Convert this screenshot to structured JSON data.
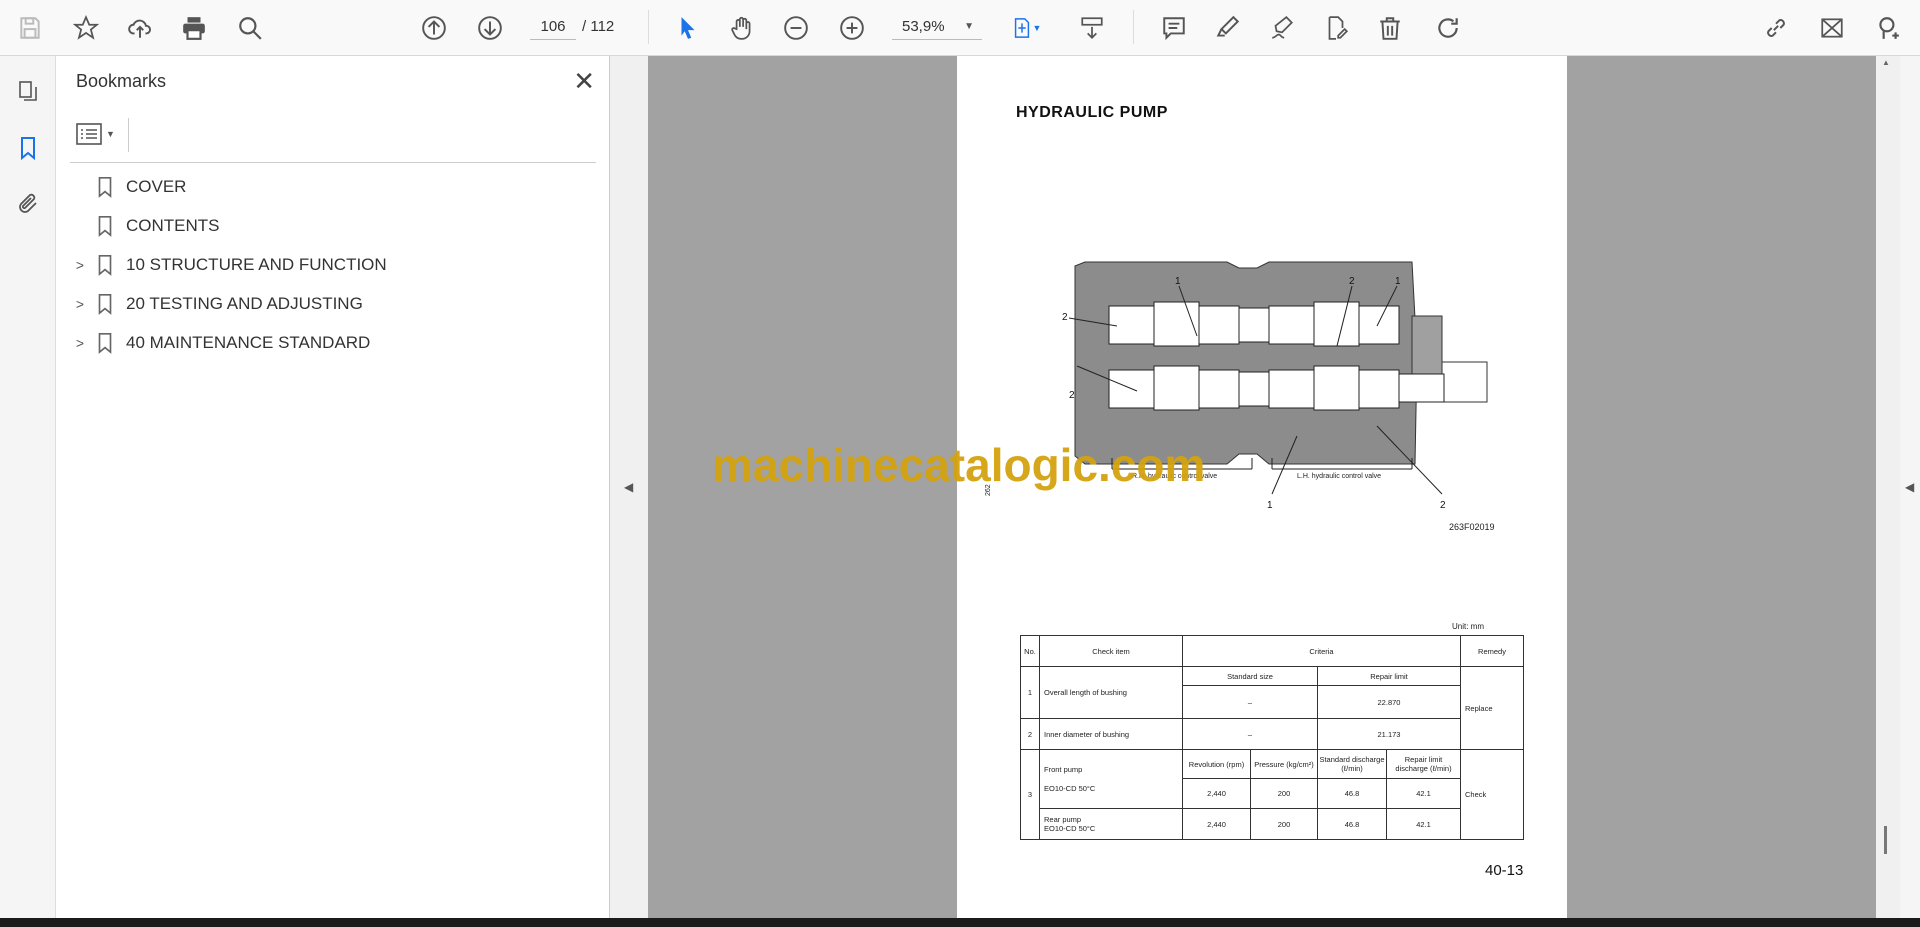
{
  "toolbar": {
    "page_current": "106",
    "page_total": "/ 112",
    "zoom": "53,9%",
    "accent_color": "#1a73e8"
  },
  "bookmarks": {
    "title": "Bookmarks",
    "items": [
      {
        "label": "COVER",
        "expandable": false
      },
      {
        "label": "CONTENTS",
        "expandable": false
      },
      {
        "label": "10 STRUCTURE AND FUNCTION",
        "expandable": true
      },
      {
        "label": "20 TESTING AND ADJUSTING",
        "expandable": true
      },
      {
        "label": "40 MAINTENANCE STANDARD",
        "expandable": true
      }
    ]
  },
  "document": {
    "title": "HYDRAULIC PUMP",
    "diagram": {
      "callouts": [
        "1",
        "2",
        "1",
        "2",
        "2",
        "1",
        "2"
      ],
      "rh_label": "R.H. hydraulic control valve",
      "lh_label": "L.H. hydraulic control valve",
      "side_code": "262",
      "figure_code": "263F02019"
    },
    "watermark": "machinecatalogic.com",
    "unit": "Unit: mm",
    "table": {
      "h_no": "No.",
      "h_item": "Check item",
      "h_criteria": "Criteria",
      "h_remedy": "Remedy",
      "h_std": "Standard size",
      "h_repair": "Repair limit",
      "r1_no": "1",
      "r1_item": "Overall length of bushing",
      "r1_std": "–",
      "r1_rep": "22.870",
      "r2_no": "2",
      "r2_item": "Inner diameter of bushing",
      "r2_std": "–",
      "r2_rep": "21.173",
      "remedy_12": "Replace",
      "r3_no": "3",
      "h_rev": "Revolution (rpm)",
      "h_press": "Pressure (kg/cm²)",
      "h_sd": "Standard discharge (ℓ/min)",
      "h_rld": "Repair limit discharge (ℓ/min)",
      "front_item": "Front pump",
      "front_cond": "EO10-CD 50°C",
      "front_vals": [
        "2,440",
        "200",
        "46.8",
        "42.1"
      ],
      "rear_item": "Rear pump",
      "rear_cond": "EO10-CD 50°C",
      "rear_vals": [
        "2,440",
        "200",
        "46.8",
        "42.1"
      ],
      "remedy_3": "Check"
    },
    "page_number": "40-13"
  }
}
